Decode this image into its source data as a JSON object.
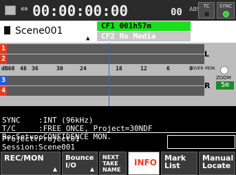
{
  "topbar": {
    "transport_icon": "⇔",
    "timecode": "00:00:00:00",
    "timecode_frames": "00",
    "abs_label": "ABS",
    "tc_label": "TC",
    "sync_label": "SYNC"
  },
  "scene": {
    "name": "Scene001",
    "arrow": "▲"
  },
  "media": {
    "cf1": "CF1 001h57m",
    "cf2": "CF2 No Media"
  },
  "meters": {
    "tracks": [
      "1",
      "2",
      "3",
      "4"
    ],
    "scale": [
      "dB60",
      "48",
      "36",
      "30",
      "24",
      "18",
      "12",
      "6",
      "0"
    ],
    "over_label": "OVER",
    "mon_label": "MON",
    "ch_l": "L",
    "ch_r": "R",
    "zoom_label": "ZOOM",
    "zoom_value": "5m"
  },
  "info": {
    "sync": "SYNC    :INT (96kHz)",
    "tc": "T/C     :FREE ONCE, Project=30NDF",
    "recsetup": "RecSetup:CONFIDENCE MON.",
    "project": "Project:Project01",
    "session": "Session:Scene001"
  },
  "buttons": {
    "rec_mon": "REC/MON",
    "bounce": "Bounce\nI/O",
    "next_take": "NEXT\nTAKE\nNAME",
    "info": "INFO",
    "mark_list": "Mark\nList",
    "manual_locate": "Manual\nLocate"
  },
  "colors": {
    "accent_red": "#e83a1a",
    "media_green": "#19e019",
    "sync_led": "#2ecf2e"
  }
}
